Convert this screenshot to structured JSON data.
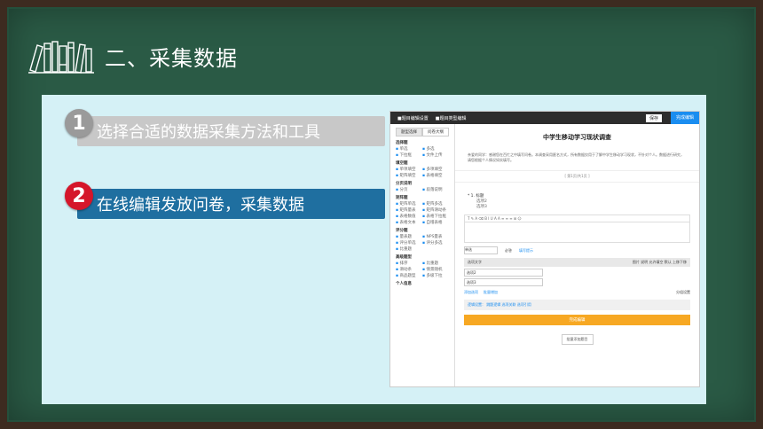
{
  "slide": {
    "title": "二、采集数据",
    "steps": [
      {
        "num": "1",
        "label": "选择合适的数据采集方法和工具"
      },
      {
        "num": "2",
        "label": "在线编辑发放问卷，采集数据"
      }
    ]
  },
  "editor": {
    "top_left": "■题目编辑设置",
    "top_mid": "■题目类型编辑",
    "save_label": "保存",
    "publish_label": "完成编辑",
    "tab_a": "题型选择",
    "tab_b": "问卷大纲",
    "groups": [
      {
        "name": "选择题",
        "items": [
          "单选",
          "多选",
          "下拉框",
          "文件上传"
        ]
      },
      {
        "name": "填空题",
        "items": [
          "单项填空",
          "多项填空",
          "矩阵填空",
          "表格填空"
        ]
      },
      {
        "name": "分页说明",
        "items": [
          "分页",
          "段落说明"
        ]
      },
      {
        "name": "矩阵题",
        "items": [
          "矩阵单选",
          "矩阵多选",
          "矩阵量表",
          "矩阵滑动条",
          "表格数值",
          "表格下拉框",
          "表格文本",
          "自增表格"
        ]
      },
      {
        "name": "评分题",
        "items": [
          "量表题",
          "NPS量表",
          "评分单选",
          "评分多选",
          "比重题"
        ]
      },
      {
        "name": "高级题型",
        "items": [
          "排序",
          "比重题",
          "滑动条",
          "情景随机",
          "商品题型",
          "多级下拉"
        ]
      },
      {
        "name": "个人信息",
        "items": []
      }
    ],
    "doc_title": "中学生移动学习现状调查",
    "doc_intro": "亲爱的同学：感谢您在百忙之中填写问卷。本调查采用匿名方式，所有数据仅用于了解中学生移动学习现状，不针对个人。数据进行研究，请您根据个人情况如实填写。",
    "pager": "[ 第1页/共1页 ]",
    "question": "* 1. 标题",
    "options_preview": [
      "选项2",
      "选项3"
    ],
    "type_select": "单选",
    "required": "必答",
    "fill_hint": "填写提示",
    "opt_header": "选项文字",
    "opt_header_right": "图片  说明  允许填空  默认  上移下移",
    "options": [
      "选项2",
      "选项3"
    ],
    "links": [
      "添加选项",
      "批量增加"
    ],
    "settings": "分组设置",
    "logic": "逻辑设置：  跳题逻辑  选项关联  选项引用",
    "done_label": "完成编辑",
    "batch_label": "批量添加题目"
  }
}
